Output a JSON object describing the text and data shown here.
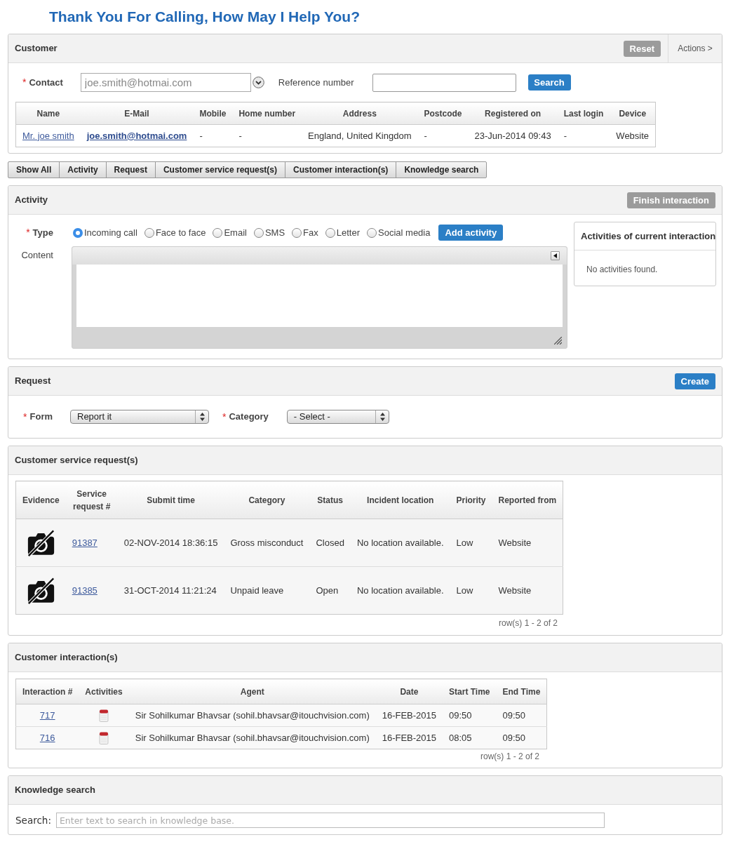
{
  "title": "Thank You For Calling, How May I Help You?",
  "customer": {
    "title": "Customer",
    "reset_button": "Reset",
    "actions_button": "Actions >",
    "contact": {
      "required_mark": "*",
      "label": "Contact",
      "value": "joe.smith@hotmai.com"
    },
    "reference": {
      "label": "Reference number"
    },
    "search_button": "Search",
    "table": {
      "columns": [
        {
          "label": "Name",
          "kind": "link"
        },
        {
          "label": "E-Mail",
          "kind": "email"
        },
        {
          "label": "Mobile",
          "kind": "text"
        },
        {
          "label": "Home number",
          "kind": "text"
        },
        {
          "label": "Address",
          "kind": "text"
        },
        {
          "label": "Postcode",
          "kind": "text"
        },
        {
          "label": "Registered on",
          "kind": "text"
        },
        {
          "label": "Last login",
          "kind": "text"
        },
        {
          "label": "Device",
          "kind": "text"
        }
      ],
      "rows": [
        [
          "Mr. joe smith",
          "joe.smith@hotmai.com",
          "-",
          "-",
          "England, United Kingdom",
          "-",
          "23-Jun-2014 09:43",
          "-",
          "Website"
        ]
      ]
    }
  },
  "sections": [
    "Show All",
    "Activity",
    "Request",
    "Customer service request(s)",
    "Customer interaction(s)",
    "Knowledge search"
  ],
  "activity": {
    "title": "Activity",
    "finish_button": "Finish interaction",
    "type": {
      "required_mark": "*",
      "label": "Type",
      "options": [
        {
          "label": "Incoming call",
          "selected": true
        },
        {
          "label": "Face to face",
          "selected": false
        },
        {
          "label": "Email",
          "selected": false
        },
        {
          "label": "SMS",
          "selected": false
        },
        {
          "label": "Fax",
          "selected": false
        },
        {
          "label": "Letter",
          "selected": false
        },
        {
          "label": "Social media",
          "selected": false
        }
      ]
    },
    "add_button": "Add activity",
    "content_label": "Content",
    "side_panel": {
      "title": "Activities of current interaction",
      "empty_text": "No activities found."
    }
  },
  "request": {
    "title": "Request",
    "create_button": "Create",
    "form": {
      "required_mark": "*",
      "label": "Form",
      "value": "Report it"
    },
    "category": {
      "required_mark": "*",
      "label": "Category",
      "value": "- Select -"
    }
  },
  "service_requests": {
    "title": "Customer service request(s)",
    "table": {
      "columns": [
        {
          "label": "Evidence",
          "kind": "evidence"
        },
        {
          "label": "Service request #",
          "kind": "link"
        },
        {
          "label": "Submit time",
          "kind": "text"
        },
        {
          "label": "Category",
          "kind": "text"
        },
        {
          "label": "Status",
          "kind": "text"
        },
        {
          "label": "Incident location",
          "kind": "text"
        },
        {
          "label": "Priority",
          "kind": "text"
        },
        {
          "label": "Reported from",
          "kind": "text"
        }
      ],
      "rows": [
        {
          "evidence": false,
          "cells": [
            "",
            "91387",
            "02-NOV-2014 18:36:15",
            "Gross misconduct",
            "Closed",
            "No location available.",
            "Low",
            "Website"
          ]
        },
        {
          "evidence": false,
          "cells": [
            "",
            "91385",
            "31-OCT-2014 11:21:24",
            "Unpaid leave",
            "Open",
            "No location available.",
            "Low",
            "Website"
          ]
        }
      ]
    },
    "pager": "row(s) 1 - 2 of 2"
  },
  "interactions": {
    "title": "Customer interaction(s)",
    "table": {
      "columns": [
        {
          "label": "Interaction #",
          "kind": "link"
        },
        {
          "label": "Activities",
          "kind": "icon"
        },
        {
          "label": "Agent",
          "kind": "text"
        },
        {
          "label": "Date",
          "kind": "text"
        },
        {
          "label": "Start Time",
          "kind": "text"
        },
        {
          "label": "End Time",
          "kind": "text"
        }
      ],
      "rows": [
        [
          "717",
          "",
          "Sir Sohilkumar Bhavsar (sohil.bhavsar@itouchvision.com)",
          "16-FEB-2015",
          "09:50",
          "09:50"
        ],
        [
          "716",
          "",
          "Sir Sohilkumar Bhavsar (sohil.bhavsar@itouchvision.com)",
          "16-FEB-2015",
          "08:05",
          "09:50"
        ]
      ]
    },
    "pager": "row(s) 1 - 2 of 2"
  },
  "knowledge": {
    "title": "Knowledge search",
    "search_label": "Search:",
    "placeholder": "Enter text to search in knowledge base."
  }
}
